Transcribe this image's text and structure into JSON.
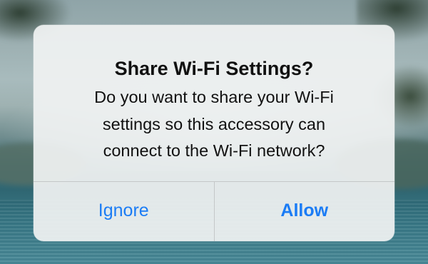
{
  "alert": {
    "title": "Share Wi-Fi Settings?",
    "message": "Do you want to share your Wi-Fi\nsettings so this accessory can\nconnect to the Wi-Fi network?",
    "buttons": {
      "ignore": "Ignore",
      "allow": "Allow"
    }
  },
  "colors": {
    "button_text": "#1b7cf5",
    "alert_background": "#f0f2f2",
    "divider": "#c4c7c8"
  }
}
